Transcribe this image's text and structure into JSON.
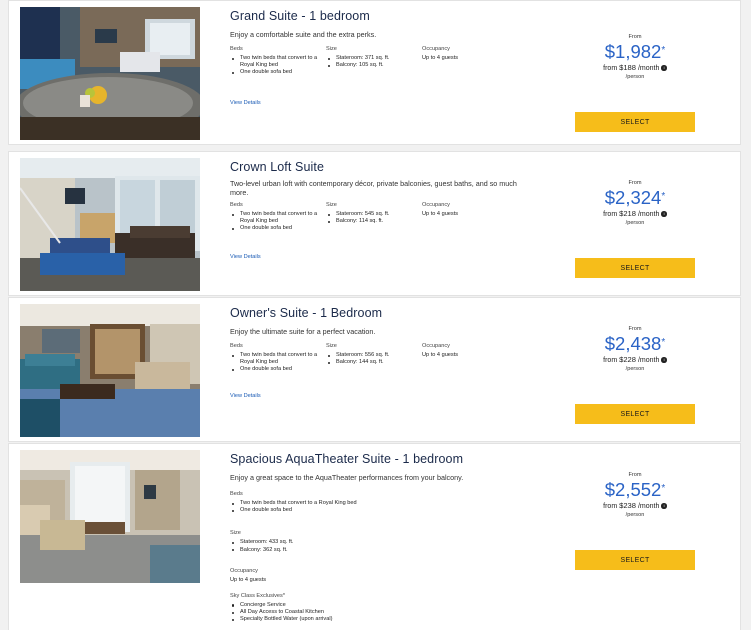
{
  "suites": [
    {
      "name": "Grand Suite - 1 bedroom",
      "description": "Enjoy a comfortable suite and the extra perks.",
      "beds_label": "Beds",
      "beds": [
        "Two twin beds that convert to a Royal King bed",
        "One double sofa bed"
      ],
      "size_label": "Size",
      "size": [
        "Stateroom: 371 sq. ft.",
        "Balcony: 105 sq. ft."
      ],
      "occupancy_label": "Occupancy",
      "occupancy": "Up to 4 guests",
      "details_label": "View Details",
      "from_label": "From",
      "price": "$1,982",
      "price_mark": "*",
      "from_prefix": "from",
      "monthly": "$188",
      "monthly_suffix": "/month",
      "info_icon": "i",
      "per_person": "/person",
      "select_label": "SELECT"
    },
    {
      "name": "Crown Loft Suite",
      "description": "Two-level urban loft with contemporary décor, private balconies, guest baths, and so much more.",
      "beds_label": "Beds",
      "beds": [
        "Two twin beds that convert to a Royal King bed",
        "One double sofa bed"
      ],
      "size_label": "Size",
      "size": [
        "Stateroom: 545 sq. ft.",
        "Balcony: 114 sq. ft."
      ],
      "occupancy_label": "Occupancy",
      "occupancy": "Up to 4 guests",
      "details_label": "View Details",
      "from_label": "From",
      "price": "$2,324",
      "price_mark": "*",
      "from_prefix": "from",
      "monthly": "$218",
      "monthly_suffix": "/month",
      "info_icon": "i",
      "per_person": "/person",
      "select_label": "SELECT"
    },
    {
      "name": "Owner's Suite - 1 Bedroom",
      "description": "Enjoy the ultimate suite for a perfect vacation.",
      "beds_label": "Beds",
      "beds": [
        "Two twin beds that convert to a Royal King bed",
        "One double sofa bed"
      ],
      "size_label": "Size",
      "size": [
        "Stateroom: 556 sq. ft.",
        "Balcony: 144 sq. ft."
      ],
      "occupancy_label": "Occupancy",
      "occupancy": "Up to 4 guests",
      "details_label": "View Details",
      "from_label": "From",
      "price": "$2,438",
      "price_mark": "*",
      "from_prefix": "from",
      "monthly": "$228",
      "monthly_suffix": "/month",
      "info_icon": "i",
      "per_person": "/person",
      "select_label": "SELECT"
    },
    {
      "name": "Spacious AquaTheater Suite - 1 bedroom",
      "description": "Enjoy a great space to the AquaTheater performances from your balcony.",
      "beds_label": "Beds",
      "beds": [
        "Two twin beds that convert to a Royal King bed",
        "One double sofa bed"
      ],
      "size_label": "Size",
      "size": [
        "Stateroom: 433 sq. ft.",
        "Balcony: 362 sq. ft."
      ],
      "occupancy_label": "Occupancy",
      "occupancy": "Up to 4 guests",
      "exclusives_label": "Sky Class Exclusives*",
      "exclusives": [
        "Concierge Service",
        "All Day Access to Coastal Kitchen",
        "Specialty Bottled Water (upon arrival)"
      ],
      "from_label": "From",
      "price": "$2,552",
      "price_mark": "*",
      "from_prefix": "from",
      "monthly": "$238",
      "monthly_suffix": "/month",
      "info_icon": "i",
      "per_person": "/person",
      "select_label": "SELECT"
    }
  ]
}
